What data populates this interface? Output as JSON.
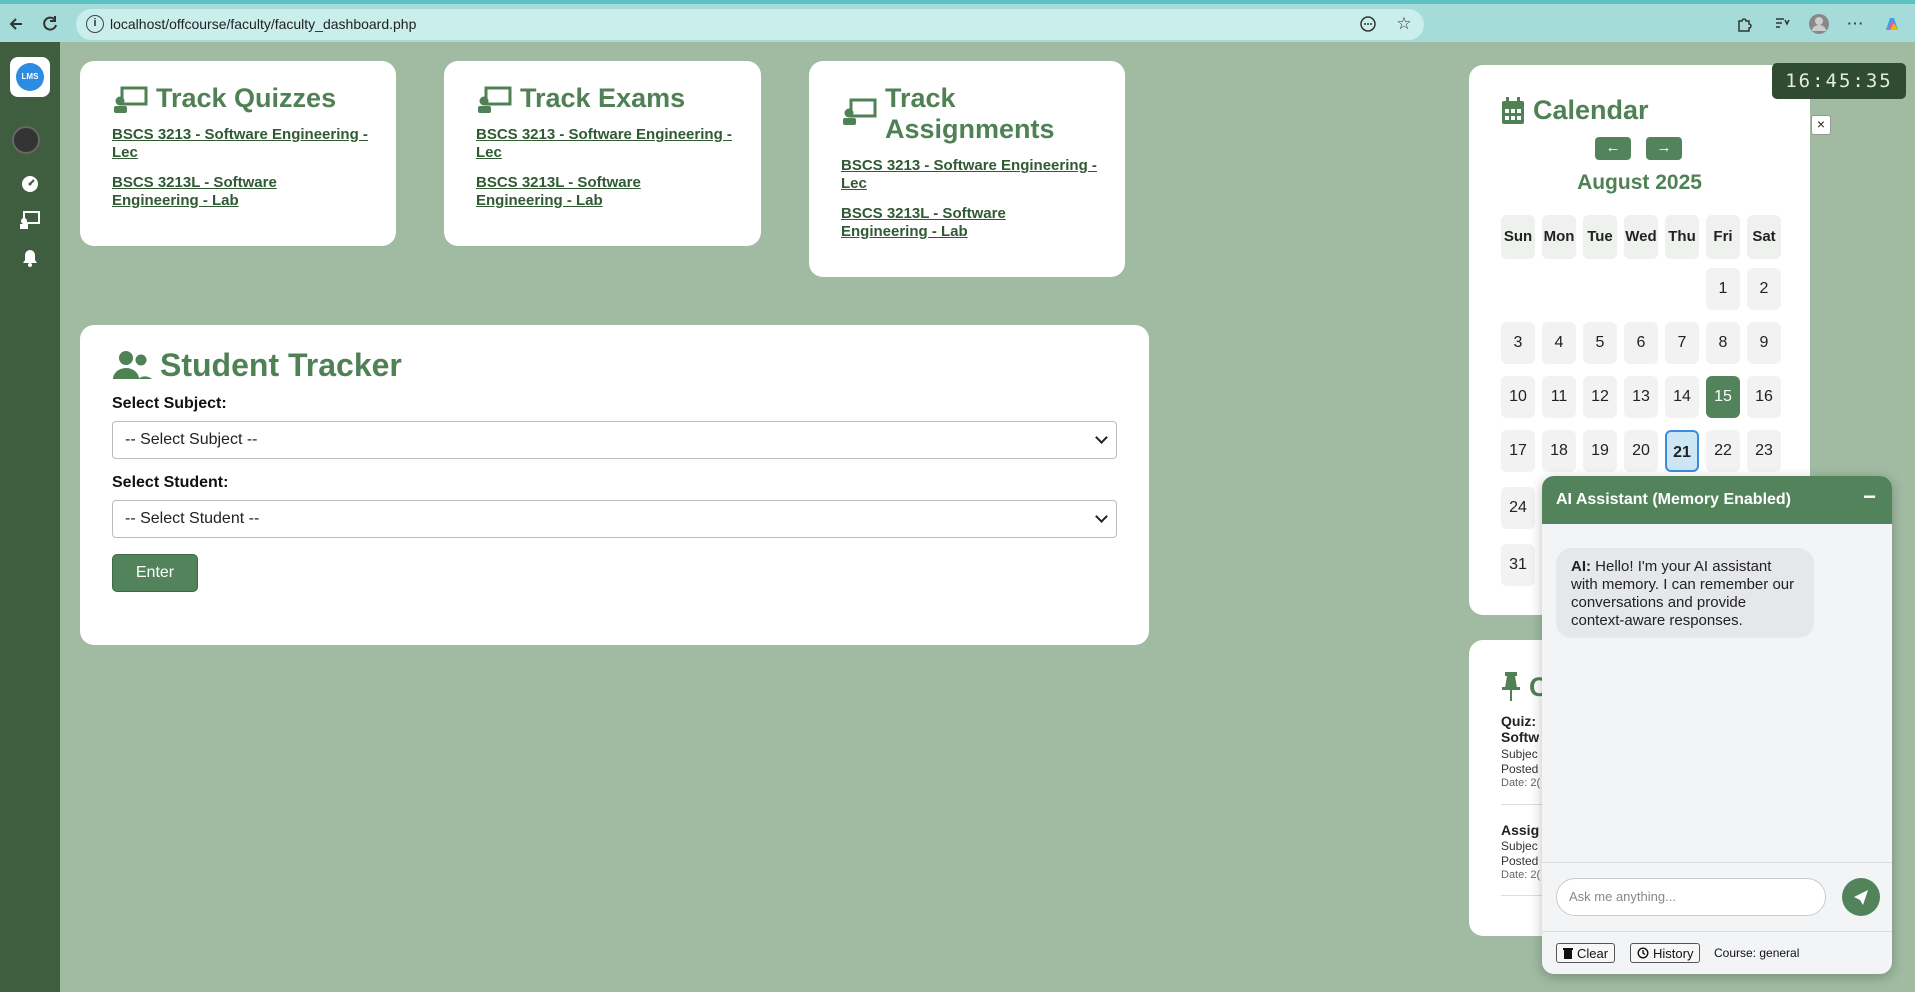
{
  "browser": {
    "url": "localhost/offcourse/faculty/faculty_dashboard.php"
  },
  "sidebar": {
    "logo_text": "LMS"
  },
  "cards": [
    {
      "title": "Track Quizzes",
      "links": [
        "BSCS 3213 - Software Engineering - Lec",
        "BSCS 3213L - Software Engineering - Lab"
      ]
    },
    {
      "title": "Track Exams",
      "links": [
        "BSCS 3213 - Software Engineering - Lec",
        "BSCS 3213L - Software Engineering - Lab"
      ]
    },
    {
      "title": "Track Assignments",
      "links": [
        "BSCS 3213 - Software Engineering - Lec",
        "BSCS 3213L - Software Engineering - Lab"
      ]
    }
  ],
  "tracker": {
    "title": "Student Tracker",
    "subject_label": "Select Subject:",
    "subject_value": "-- Select Subject --",
    "student_label": "Select Student:",
    "student_value": "-- Select Student --",
    "enter_label": "Enter"
  },
  "calendar": {
    "title": "Calendar",
    "prev": "←",
    "next": "→",
    "month": "August 2025",
    "days": [
      "Sun",
      "Mon",
      "Tue",
      "Wed",
      "Thu",
      "Fri",
      "Sat"
    ],
    "rows": [
      [
        "",
        "",
        "",
        "",
        "",
        "1",
        "2"
      ],
      [
        "3",
        "4",
        "5",
        "6",
        "7",
        "8",
        "9"
      ],
      [
        "10",
        "11",
        "12",
        "13",
        "14",
        "15",
        "16"
      ],
      [
        "17",
        "18",
        "19",
        "20",
        "21",
        "22",
        "23"
      ],
      [
        "24"
      ],
      [
        "31"
      ]
    ],
    "today": "15",
    "selected": "21"
  },
  "clock": "16:45:35",
  "close_label": "×",
  "announcements": {
    "title_fragment": "C",
    "items": [
      {
        "title_1": "Quiz:",
        "title_2": "Softw",
        "subject": "Subjec",
        "posted": "Posted",
        "date": "Date: 2("
      },
      {
        "title_1": "Assig",
        "subject": "Subjec",
        "posted": "Posted",
        "date": "Date: 2("
      }
    ]
  },
  "chat": {
    "title": "AI Assistant (Memory Enabled)",
    "minimize": "−",
    "message_prefix": "AI:",
    "message": "Hello! I'm your AI assistant with memory. I can remember our conversations and provide context-aware responses.",
    "input_placeholder": "Ask me anything...",
    "clear_label": "Clear",
    "history_label": "History",
    "course_label": "Course: general"
  }
}
